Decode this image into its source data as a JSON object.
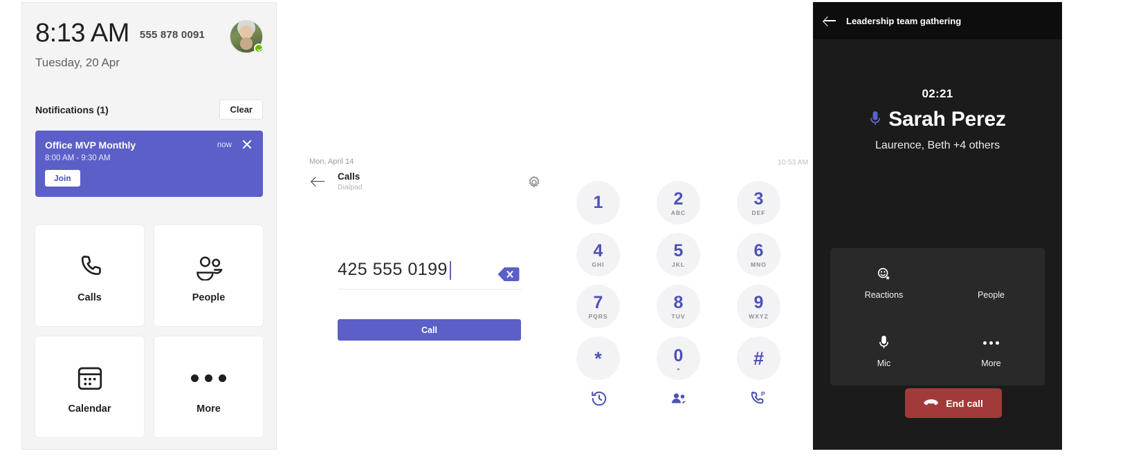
{
  "home": {
    "time": "8:13 AM",
    "phone_number": "555 878 0091",
    "date": "Tuesday, 20 Apr",
    "presence_icon": "available-check-icon",
    "avatar_icon": "user-avatar",
    "notifications": {
      "heading": "Notifications (1)",
      "clear_label": "Clear",
      "items": [
        {
          "title": "Office MVP Monthly",
          "time_ago": "now",
          "subtitle": "8:00 AM - 9:30 AM",
          "action_label": "Join",
          "close_icon": "close-icon",
          "accent": "#5b5fc7"
        }
      ]
    },
    "tiles": [
      {
        "label": "Calls",
        "icon": "phone-icon"
      },
      {
        "label": "People",
        "icon": "people-icon"
      },
      {
        "label": "Calendar",
        "icon": "calendar-icon"
      },
      {
        "label": "More",
        "icon": "more-dots-icon"
      }
    ]
  },
  "dialpad": {
    "date": "Mon, April 14",
    "status_time": "10:53 AM",
    "back_icon": "back-arrow-icon",
    "title": "Calls",
    "subtitle": "Dialpad",
    "settings_icon": "gear-icon",
    "entered_number": "425 555 0199",
    "backspace_icon": "backspace-icon",
    "call_label": "Call",
    "keys": [
      {
        "digit": "1",
        "letters": ""
      },
      {
        "digit": "2",
        "letters": "ABC"
      },
      {
        "digit": "3",
        "letters": "DEF"
      },
      {
        "digit": "4",
        "letters": "GHI"
      },
      {
        "digit": "5",
        "letters": "JKL"
      },
      {
        "digit": "6",
        "letters": "MNO"
      },
      {
        "digit": "7",
        "letters": "PQRS"
      },
      {
        "digit": "8",
        "letters": "TUV"
      },
      {
        "digit": "9",
        "letters": "WXYZ"
      },
      {
        "digit": "*",
        "letters": ""
      },
      {
        "digit": "0",
        "letters": ""
      },
      {
        "digit": "#",
        "letters": ""
      }
    ],
    "actions": [
      {
        "icon": "call-history-icon"
      },
      {
        "icon": "contacts-icon"
      },
      {
        "icon": "parked-call-icon"
      }
    ],
    "accent": "#5b5fc7",
    "key_text_color": "#4d52b5"
  },
  "call": {
    "meeting_title": "Leadership team gathering",
    "back_icon": "back-arrow-icon",
    "duration": "02:21",
    "active_speaker": "Sarah Perez",
    "speaker_mic_icon": "microphone-active-icon",
    "participants": "Laurence, Beth +4 others",
    "controls": [
      {
        "label": "Reactions",
        "icon": "reactions-icon"
      },
      {
        "label": "People",
        "icon": "people-icon"
      },
      {
        "label": "Mic",
        "icon": "microphone-icon"
      },
      {
        "label": "More",
        "icon": "more-dots-icon"
      }
    ],
    "end_call_label": "End call",
    "end_call_icon": "end-call-icon",
    "end_call_color": "#a33a3a"
  }
}
